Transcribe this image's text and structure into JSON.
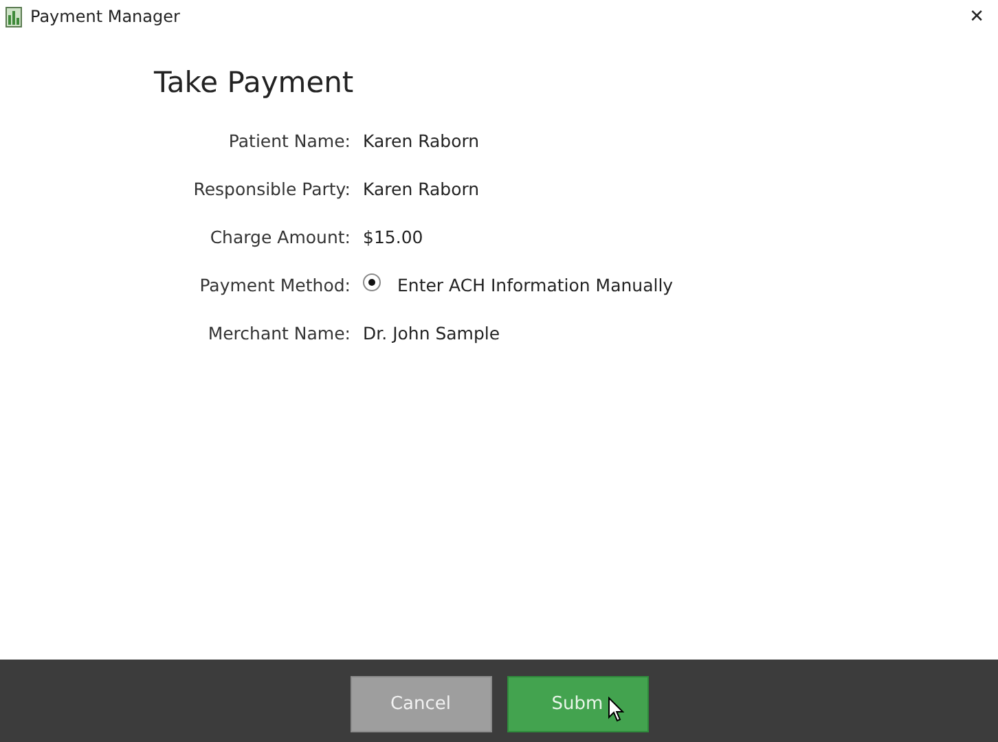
{
  "window": {
    "title": "Payment Manager",
    "close": "✕"
  },
  "heading": "Take Payment",
  "fields": [
    {
      "kind": "text",
      "label": "Patient Name:",
      "value": "Karen Raborn"
    },
    {
      "kind": "text",
      "label": "Responsible Party:",
      "value": "Karen Raborn"
    },
    {
      "kind": "text",
      "label": "Charge Amount:",
      "value": "$15.00"
    },
    {
      "kind": "radio",
      "label": "Payment Method:",
      "value": "Enter ACH Information Manually",
      "selected": true
    },
    {
      "kind": "text",
      "label": "Merchant Name:",
      "value": "Dr. John Sample"
    }
  ],
  "buttons": [
    {
      "kind": "secondary",
      "label": "Cancel"
    },
    {
      "kind": "primary",
      "label": "Subm",
      "hovered": true
    }
  ]
}
